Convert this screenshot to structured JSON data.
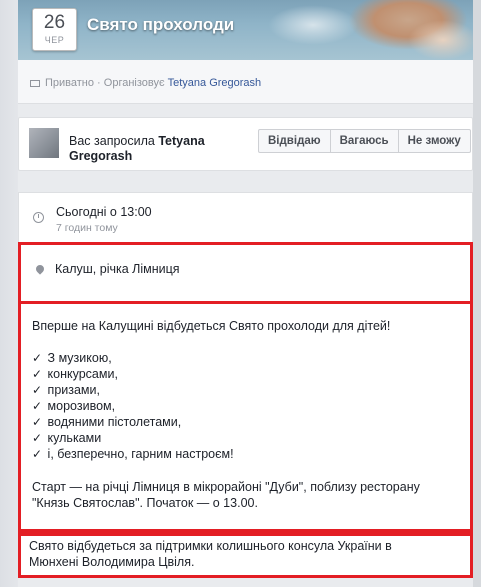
{
  "event": {
    "date_day": "26",
    "date_month": "ЧЕР",
    "title": "Свято прохолоди",
    "privacy": "Приватно · Організовує",
    "organizer": "Tetyana Gregorash"
  },
  "invite": {
    "prefix": "Вас запросила",
    "name_line1": "Tetyana",
    "name_line2": "Gregorash",
    "buttons": [
      "Відвідаю",
      "Вагаюсь",
      "Не зможу"
    ]
  },
  "time": {
    "main": "Сьогодні о 13:00",
    "sub": "7 годин тому"
  },
  "location": "Калуш, річка Лімниця",
  "description": {
    "intro": "Вперше на Калущині відбудеться Свято прохолоди для дітей!",
    "items": [
      "З музикою,",
      "конкурсами,",
      "призами,",
      "морозивом,",
      "водяними пістолетами,",
      "кульками",
      "і, безперечно, гарним настроєм!"
    ],
    "start_line1": "Старт — на річці Лімниця в мікрорайоні \"Дуби\", поблизу ресторану",
    "start_line2": "\"Князь Святослав\". Початок — о 13.00."
  },
  "footer": {
    "line1": "Свято відбудеться за підтримки колишнього консула України в",
    "line2": "Мюнхені Володимира Цвіля."
  }
}
